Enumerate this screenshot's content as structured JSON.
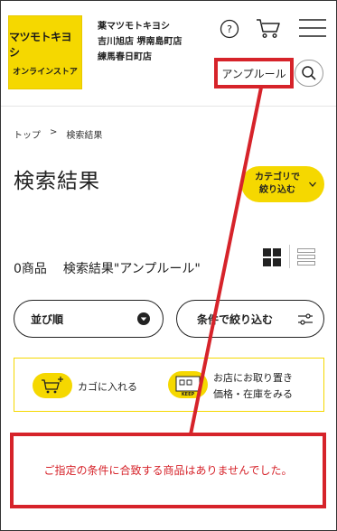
{
  "header": {
    "logo_main": "マツモトキヨシ",
    "logo_sub": "オンラインストア",
    "store_lines": [
      "薬マツモトキヨシ",
      "吉川旭店 堺南島町店",
      "練馬春日町店"
    ],
    "help_icon": "question-circle-icon",
    "cart_icon": "cart-icon",
    "menu_icon": "hamburger-menu-icon"
  },
  "search": {
    "value": "アンプルール",
    "button_icon": "search-icon"
  },
  "breadcrumb": {
    "home": "トップ",
    "separator": ">",
    "current": "検索結果"
  },
  "page": {
    "title": "検索結果",
    "category_button_line1": "カテゴリで",
    "category_button_line2": "絞り込む"
  },
  "results": {
    "count_label": "0商品",
    "query_label": "検索結果\"アンプルール\""
  },
  "controls": {
    "sort_label": "並び順",
    "filter_label": "条件で絞り込む"
  },
  "info_banner": {
    "add_cart_label": "カゴに入れる",
    "keep_badge": "KEEP",
    "pickup_line1": "お店にお取り置き",
    "pickup_line2": "価格・在庫をみる"
  },
  "empty_message": "ご指定の条件に合致する商品はありませんでした。",
  "colors": {
    "brand_yellow": "#f5d800",
    "annotation_red": "#d6232a"
  }
}
